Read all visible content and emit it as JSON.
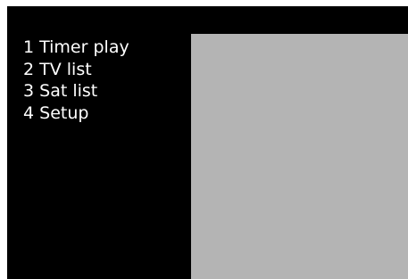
{
  "menu": {
    "items": [
      {
        "label": "1 Timer play"
      },
      {
        "label": "2 TV list"
      },
      {
        "label": "3 Sat list"
      },
      {
        "label": "4 Setup"
      }
    ]
  },
  "colors": {
    "background": "#000000",
    "text": "#ffffff",
    "preview": "#b4b4b4"
  }
}
